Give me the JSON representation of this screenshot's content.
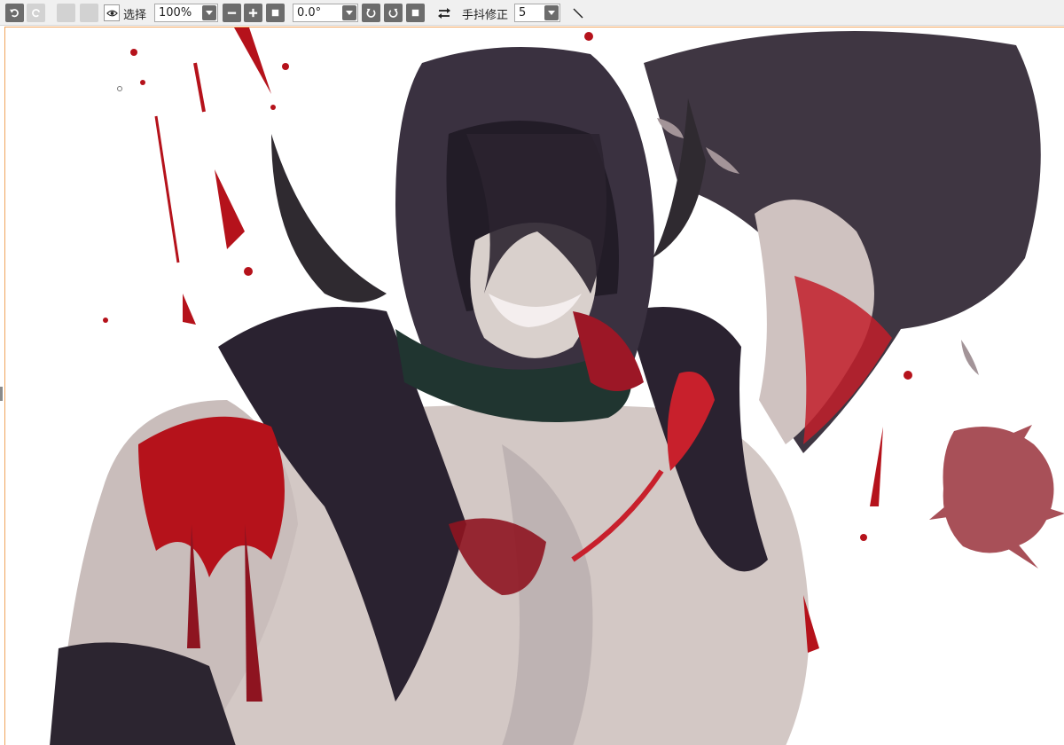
{
  "toolbar": {
    "select_label": "选择",
    "zoom_value": "100%",
    "rotation_value": "0.0°",
    "stabilizer_label": "手抖修正",
    "stabilizer_value": "5"
  },
  "canvas": {
    "background": "#ffffff",
    "border_color": "#f0a45c",
    "palette": {
      "blood": "#b5121b",
      "dark_blood": "#6e0f18",
      "skin": "#d9d0cc",
      "skin_shadow": "#a9999a",
      "hood": "#3a3140",
      "hood_dark": "#221c27",
      "splat": "#a85058"
    }
  }
}
